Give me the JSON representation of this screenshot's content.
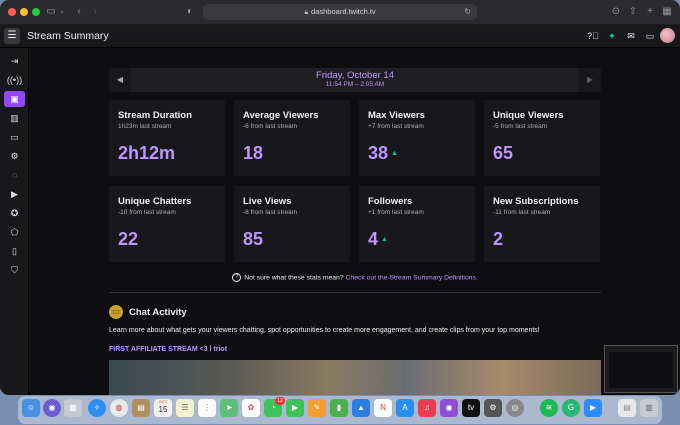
{
  "browser": {
    "url": "dashboard.twitch.tv"
  },
  "topbar": {
    "title": "Stream Summary"
  },
  "date_nav": {
    "date": "Friday, October 14",
    "time_range": "11:54 PM – 2:05 AM"
  },
  "stats": [
    {
      "title": "Stream Duration",
      "sub": "1h23m last stream",
      "value": "2h12m",
      "arrow": ""
    },
    {
      "title": "Average Viewers",
      "sub": "-6 from last stream",
      "value": "18",
      "arrow": ""
    },
    {
      "title": "Max Viewers",
      "sub": "+7 from last stream",
      "value": "38",
      "arrow": "▲"
    },
    {
      "title": "Unique Viewers",
      "sub": "-5 from last stream",
      "value": "65",
      "arrow": ""
    },
    {
      "title": "Unique Chatters",
      "sub": "-10 from last stream",
      "value": "22",
      "arrow": ""
    },
    {
      "title": "Live Views",
      "sub": "-8 from last stream",
      "value": "85",
      "arrow": ""
    },
    {
      "title": "Followers",
      "sub": "+1 from last stream",
      "value": "4",
      "arrow": "▲"
    },
    {
      "title": "New Subscriptions",
      "sub": "-11 from last stream",
      "value": "2",
      "arrow": ""
    }
  ],
  "info": {
    "text": "Not sure what these stats mean?",
    "link": "Check out the Stream Summary Definitions."
  },
  "chat": {
    "title": "Chat Activity",
    "description": "Learn more about what gets your viewers chatting, spot opportunities to create more engagement, and create clips from your top moments!",
    "stream_link": "FIRST AFFILIATE STREAM <3 l triot"
  },
  "dock": {
    "calendar_day": "15",
    "calendar_month": "OCT",
    "badge": "12"
  },
  "colors": {
    "accent": "#9147ff",
    "accent_text": "#bf94ff",
    "up_arrow": "#00c8af",
    "card_bg": "#18181b",
    "page_bg": "#0e0e10"
  },
  "icons": {
    "sidebar": [
      "arrow-right-icon",
      "broadcast-icon",
      "stream-summary-icon",
      "analytics-icon",
      "content-icon",
      "gear-icon",
      "chat-icon",
      "video-icon",
      "achievements-icon",
      "extensions-icon",
      "book-icon",
      "shield-icon"
    ],
    "topbar": [
      "help-icon",
      "sparkle-icon",
      "mail-icon",
      "whisper-icon",
      "avatar"
    ]
  }
}
